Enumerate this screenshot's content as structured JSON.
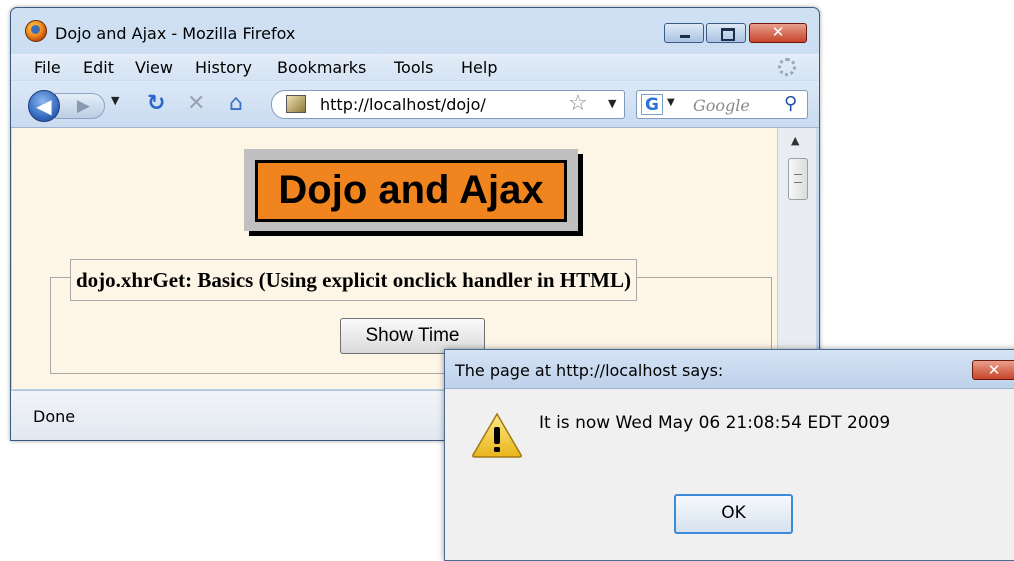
{
  "browser": {
    "window_title": "Dojo and Ajax - Mozilla Firefox",
    "menu": [
      "File",
      "Edit",
      "View",
      "History",
      "Bookmarks",
      "Tools",
      "Help"
    ],
    "url": "http://localhost/dojo/",
    "search_placeholder": "Google",
    "search_engine_letter": "G",
    "status": "Done"
  },
  "page": {
    "banner_title": "Dojo and Ajax",
    "fieldset_legend": "dojo.xhrGet: Basics (Using explicit onclick handler in HTML)",
    "button_label": "Show Time",
    "banner_color": "#f0841f",
    "background_color": "#fdf5e6"
  },
  "dialog": {
    "title": "The page at http://localhost says:",
    "message": "It is now Wed May 06 21:08:54 EDT 2009",
    "ok_label": "OK",
    "icon": "warning-icon"
  }
}
